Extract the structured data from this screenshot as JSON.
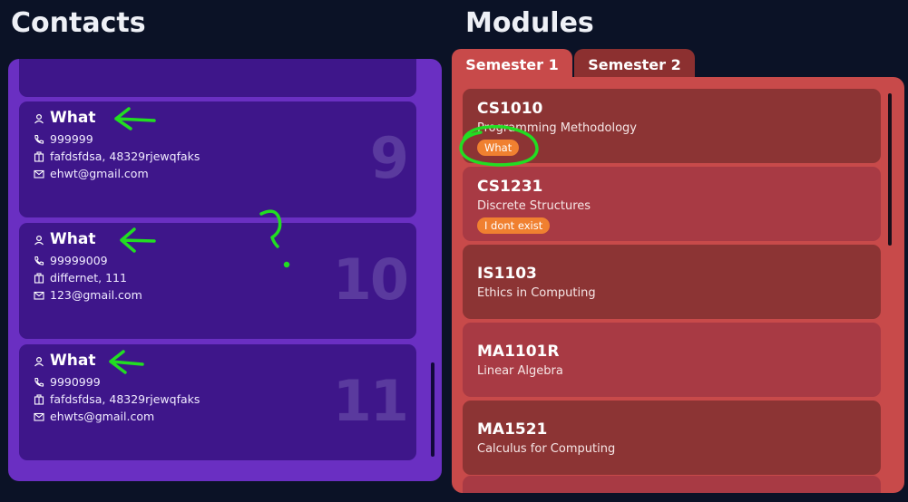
{
  "contacts": {
    "title": "Contacts",
    "cards": [
      {
        "name": "What",
        "phone": "999999",
        "address": "fafdsfdsa, 48329rjewqfaks",
        "email": "ehwt@gmail.com",
        "index": "9"
      },
      {
        "name": "What",
        "phone": "99999009",
        "address": "differnet, 111",
        "email": "123@gmail.com",
        "index": "10"
      },
      {
        "name": "What",
        "phone": "9990999",
        "address": "fafdsfdsa, 48329rjewqfaks",
        "email": "ehwts@gmail.com",
        "index": "11"
      }
    ]
  },
  "modules": {
    "title": "Modules",
    "tabs": [
      {
        "label": "Semester 1",
        "active": true
      },
      {
        "label": "Semester 2",
        "active": false
      }
    ],
    "cards": [
      {
        "code": "CS1010",
        "name": "Programming Methodology",
        "tag": "What"
      },
      {
        "code": "CS1231",
        "name": "Discrete Structures",
        "tag": "I dont exist"
      },
      {
        "code": "IS1103",
        "name": "Ethics in Computing"
      },
      {
        "code": "MA1101R",
        "name": "Linear Algebra"
      },
      {
        "code": "MA1521",
        "name": "Calculus for Computing"
      }
    ]
  },
  "colors": {
    "background": "#0b1226",
    "contacts_panel": "#6a2fc2",
    "contact_card": "#3e168a",
    "modules_panel": "#c84a4a",
    "module_card_dark": "#8c3434",
    "module_card_light": "#a83a44",
    "tag": "#f08030",
    "annotation": "#22dd22"
  },
  "icons": [
    "person-icon",
    "phone-icon",
    "building-icon",
    "mail-icon"
  ]
}
